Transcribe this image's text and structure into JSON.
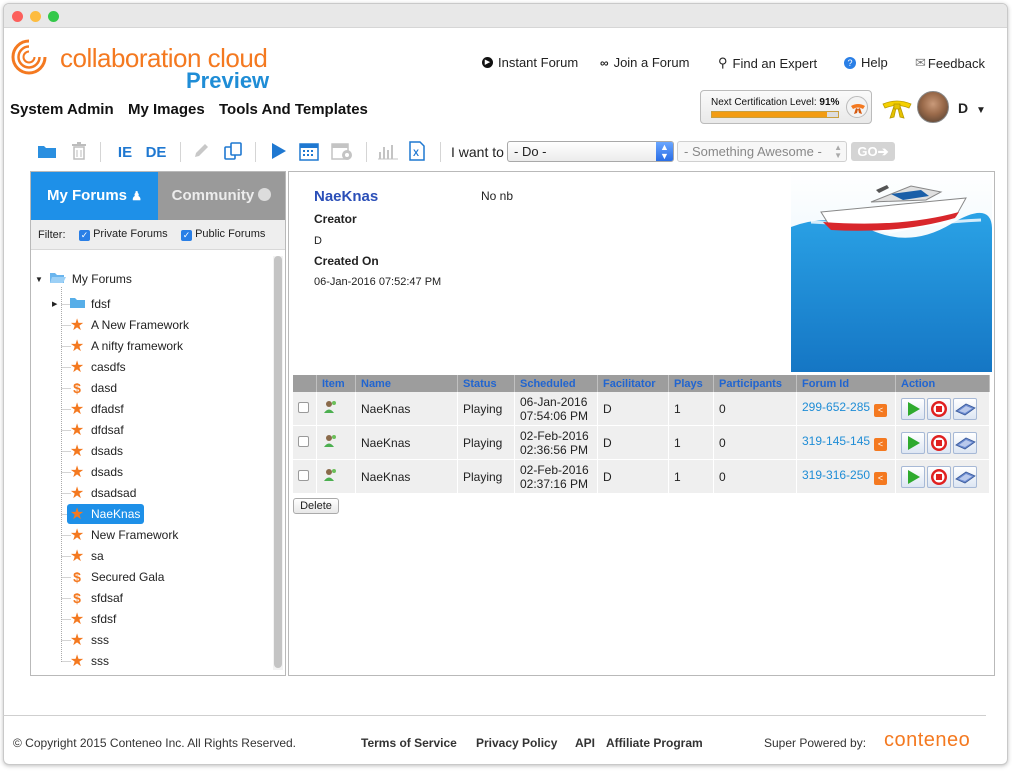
{
  "app": {
    "brand": "collaboration cloud",
    "brand_sub": "Preview"
  },
  "topnav": {
    "instant_forum": "Instant Forum",
    "join_forum": "Join a Forum",
    "find_expert": "Find an Expert",
    "help": "Help",
    "feedback": "Feedback"
  },
  "mainnav": {
    "system_admin": "System Admin",
    "my_images": "My Images",
    "tools_templates": "Tools And Templates"
  },
  "certification": {
    "label": "Next Certification Level:",
    "percent_text": "91%",
    "progress": 0.91
  },
  "user": {
    "initial": "D"
  },
  "toolbar": {
    "ie_label": "IE",
    "de_label": "DE",
    "want_label": "I want to",
    "do_value": "- Do -",
    "something_value": "- Something Awesome -",
    "go_label": "GO"
  },
  "left": {
    "tab_my": "My Forums",
    "tab_community": "Community",
    "filter_label": "Filter:",
    "private_label": "Private Forums",
    "public_label": "Public Forums",
    "root_label": "My Forums",
    "items": [
      {
        "label": "fdsf",
        "icon": "folder-icon"
      },
      {
        "label": "A New Framework",
        "icon": "star-icon"
      },
      {
        "label": "A nifty framework",
        "icon": "star-icon"
      },
      {
        "label": "casdfs",
        "icon": "star-icon"
      },
      {
        "label": "dasd",
        "icon": "dollar-icon"
      },
      {
        "label": "dfadsf",
        "icon": "star-icon"
      },
      {
        "label": "dfdsaf",
        "icon": "star-icon"
      },
      {
        "label": "dsads",
        "icon": "star-icon"
      },
      {
        "label": "dsads",
        "icon": "star-icon"
      },
      {
        "label": "dsadsad",
        "icon": "star-icon"
      },
      {
        "label": "NaeKnas",
        "icon": "star-icon"
      },
      {
        "label": "New Framework",
        "icon": "star-icon"
      },
      {
        "label": "sa",
        "icon": "star-icon"
      },
      {
        "label": "Secured Gala",
        "icon": "dollar-icon"
      },
      {
        "label": "sfdsaf",
        "icon": "dollar-icon"
      },
      {
        "label": "sfdsf",
        "icon": "star-icon"
      },
      {
        "label": "sss",
        "icon": "star-icon"
      },
      {
        "label": "sss",
        "icon": "star-icon"
      }
    ]
  },
  "detail": {
    "title": "NaeKnas",
    "note": "No nb",
    "creator_label": "Creator",
    "creator_value": "D",
    "created_label": "Created On",
    "created_value": "06-Jan-2016 07:52:47 PM"
  },
  "table": {
    "headers": [
      "Item",
      "Name",
      "Status",
      "Scheduled",
      "Facilitator",
      "Plays",
      "Participants",
      "Forum Id",
      "Action"
    ],
    "rows": [
      {
        "name": "NaeKnas",
        "status": "Playing",
        "date": "06-Jan-2016",
        "time": "07:54:06 PM",
        "facilitator": "D",
        "plays": "1",
        "participants": "0",
        "forum_id": "299-652-285"
      },
      {
        "name": "NaeKnas",
        "status": "Playing",
        "date": "02-Feb-2016",
        "time": "02:36:56 PM",
        "facilitator": "D",
        "plays": "1",
        "participants": "0",
        "forum_id": "319-145-145"
      },
      {
        "name": "NaeKnas",
        "status": "Playing",
        "date": "02-Feb-2016",
        "time": "02:37:16 PM",
        "facilitator": "D",
        "plays": "1",
        "participants": "0",
        "forum_id": "319-316-250"
      }
    ],
    "delete_label": "Delete"
  },
  "footer": {
    "copyright": "© Copyright 2015 Conteneo Inc. All Rights Reserved.",
    "terms": "Terms of Service",
    "privacy": "Privacy Policy",
    "api": "API",
    "affiliate": "Affiliate Program",
    "powered": "Super Powered by:",
    "powered_brand": "conteneo"
  },
  "colors": {
    "brand_orange": "#f47920",
    "brand_blue": "#1f8dd6",
    "tab_active": "#1e90e8",
    "tab_inactive": "#9a9a9a"
  }
}
